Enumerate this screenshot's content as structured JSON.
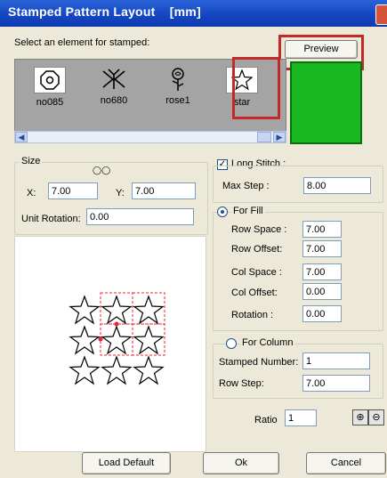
{
  "window": {
    "title": "Stamped Pattern Layout    [mm]"
  },
  "select_label": "Select an element for stamped:",
  "preview_button": "Preview",
  "elements": [
    {
      "name": "no085",
      "icon": "octagon-circle-icon"
    },
    {
      "name": "no680",
      "icon": "ornament-icon"
    },
    {
      "name": "rose1",
      "icon": "rose-icon"
    },
    {
      "name": "star",
      "icon": "star-icon"
    }
  ],
  "size": {
    "label": "Size",
    "x_label": "X:",
    "x_value": "7.00",
    "y_label": "Y:",
    "y_value": "7.00",
    "unit_rotation_label": "Unit Rotation:",
    "unit_rotation_value": "0.00"
  },
  "long_stitch": {
    "label": "Long Stitch :",
    "checked": true,
    "max_step_label": "Max Step :",
    "max_step_value": "8.00"
  },
  "for_fill": {
    "label": "For Fill",
    "selected": true,
    "row_space_label": "Row Space :",
    "row_space_value": "7.00",
    "row_offset_label": "Row Offset:",
    "row_offset_value": "7.00",
    "col_space_label": "Col Space :",
    "col_space_value": "7.00",
    "col_offset_label": "Col Offset:",
    "col_offset_value": "0.00",
    "rotation_label": "Rotation :",
    "rotation_value": "0.00"
  },
  "for_column": {
    "label": "For Column",
    "selected": false,
    "stamped_number_label": "Stamped Number:",
    "stamped_number_value": "1",
    "row_step_label": "Row Step:",
    "row_step_value": "7.00"
  },
  "ratio": {
    "label": "Ratio",
    "value": "1"
  },
  "buttons": {
    "load_default": "Load Default",
    "ok": "Ok",
    "cancel": "Cancel"
  },
  "colors": {
    "titlebar": "#1546c3",
    "highlight": "#c22a2a",
    "stamp_green": "#18b820"
  }
}
